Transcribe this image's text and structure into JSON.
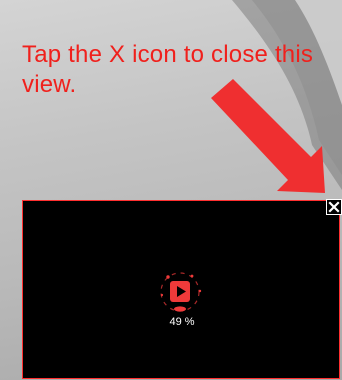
{
  "instruction": {
    "text": "Tap the X icon to close this view."
  },
  "close_control": {
    "icon": "close-icon"
  },
  "video": {
    "loader_icon": "play-icon",
    "progress_percent": 49,
    "progress_text": "49 %"
  },
  "colors": {
    "instruction_text": "#f0201c",
    "arrow": "#ef2f30",
    "overlay_background": "#000000",
    "overlay_border": "#ff2f2f",
    "loader_accent": "#ef3a3a",
    "progress_text": "#ffffff"
  }
}
